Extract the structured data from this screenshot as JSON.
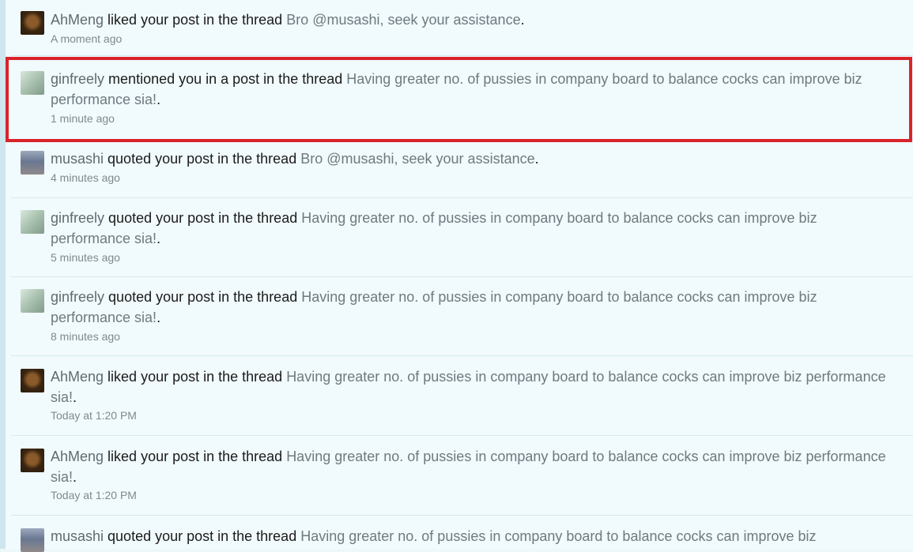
{
  "notifications": [
    {
      "user": "AhMeng",
      "avatar": "ahmeng",
      "action": " liked your post in the thread ",
      "thread": "Bro @musashi, seek your assistance",
      "time": "A moment ago"
    },
    {
      "user": "ginfreely",
      "avatar": "ginfreely",
      "action": " mentioned you in a post in the thread ",
      "thread": "Having greater no. of pussies in company board to balance cocks can improve biz performance sia!",
      "time": "1 minute ago"
    },
    {
      "user": "musashi",
      "avatar": "musashi",
      "action": " quoted your post in the thread ",
      "thread": "Bro @musashi, seek your assistance",
      "time": "4 minutes ago"
    },
    {
      "user": "ginfreely",
      "avatar": "ginfreely",
      "action": " quoted your post in the thread ",
      "thread": "Having greater no. of pussies in company board to balance cocks can improve biz performance sia!",
      "time": "5 minutes ago"
    },
    {
      "user": "ginfreely",
      "avatar": "ginfreely",
      "action": " quoted your post in the thread ",
      "thread": "Having greater no. of pussies in company board to balance cocks can improve biz performance sia!",
      "time": "8 minutes ago"
    },
    {
      "user": "AhMeng",
      "avatar": "ahmeng",
      "action": " liked your post in the thread ",
      "thread": "Having greater no. of pussies in company board to balance cocks can improve biz performance sia!",
      "time": "Today at 1:20 PM"
    },
    {
      "user": "AhMeng",
      "avatar": "ahmeng",
      "action": " liked your post in the thread ",
      "thread": "Having greater no. of pussies in company board to balance cocks can improve biz performance sia!",
      "time": "Today at 1:20 PM"
    },
    {
      "user": "musashi",
      "avatar": "musashi",
      "action": " quoted your post in the thread ",
      "thread": "Having greater no. of pussies in company board to balance cocks can improve biz",
      "time": ""
    }
  ],
  "punct": "."
}
